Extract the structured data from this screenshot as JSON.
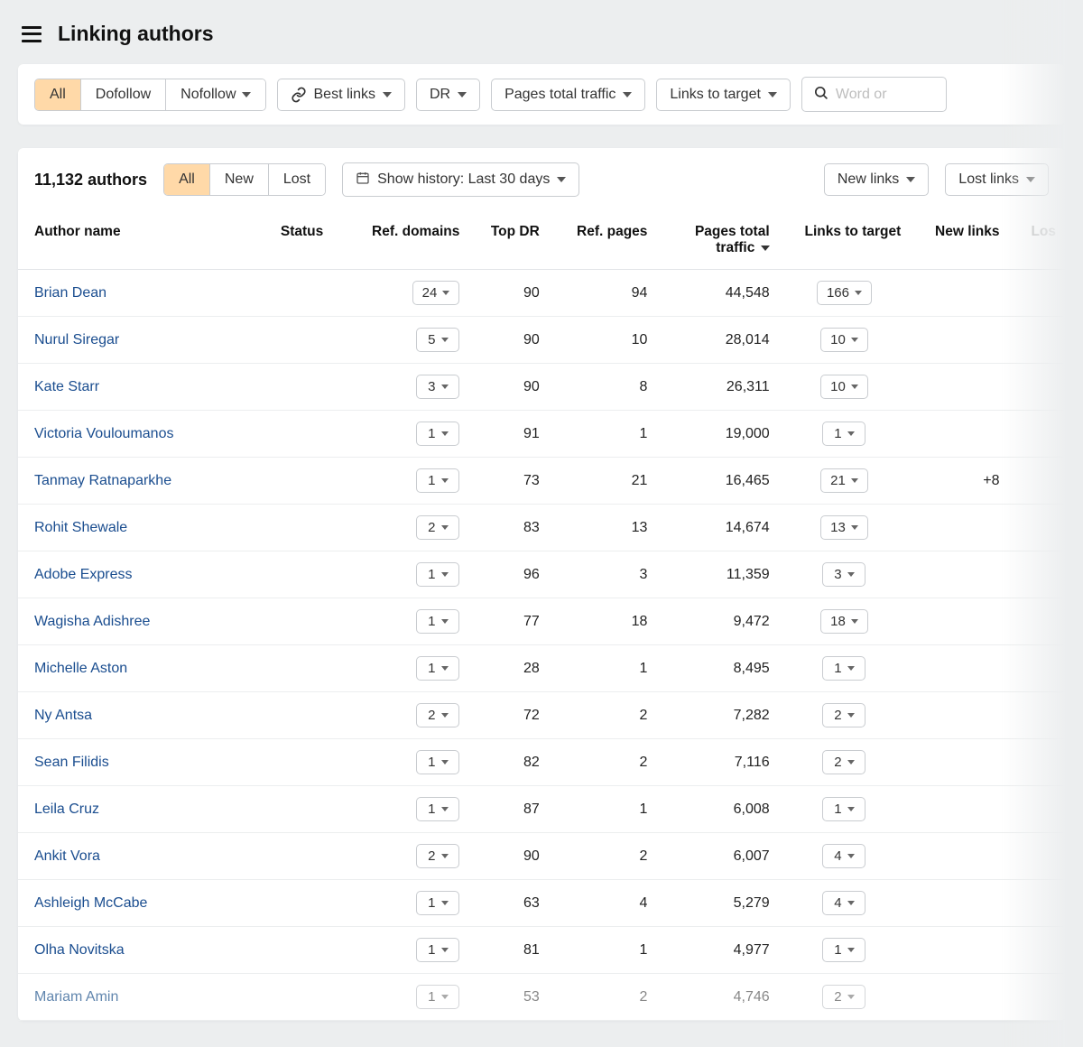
{
  "page": {
    "title": "Linking authors"
  },
  "filterTabs": {
    "all": "All",
    "dofollow": "Dofollow",
    "nofollow": "Nofollow"
  },
  "filterButtons": {
    "bestLinks": "Best links",
    "dr": "DR",
    "pagesTraffic": "Pages total traffic",
    "linksToTarget": "Links to target"
  },
  "search": {
    "placeholder": "Word or"
  },
  "counter": {
    "text": "11,132 authors"
  },
  "statusTabs": {
    "all": "All",
    "new": "New",
    "lost": "Lost"
  },
  "historyBtn": {
    "label": "Show history: Last 30 days"
  },
  "linkBtns": {
    "newLinks": "New links",
    "lostLinks": "Lost links"
  },
  "columns": {
    "author": "Author name",
    "status": "Status",
    "refDomains": "Ref. domains",
    "topDr": "Top DR",
    "refPages": "Ref. pages",
    "pagesTraffic": "Pages total traffic",
    "linksToTarget": "Links to target",
    "newLinks": "New links",
    "lostLinks": "Los"
  },
  "rows": [
    {
      "author": "Brian Dean",
      "refDomains": "24",
      "topDr": "90",
      "refPages": "94",
      "traffic": "44,548",
      "linksToTarget": "166",
      "newLinks": ""
    },
    {
      "author": "Nurul Siregar",
      "refDomains": "5",
      "topDr": "90",
      "refPages": "10",
      "traffic": "28,014",
      "linksToTarget": "10",
      "newLinks": ""
    },
    {
      "author": "Kate Starr",
      "refDomains": "3",
      "topDr": "90",
      "refPages": "8",
      "traffic": "26,311",
      "linksToTarget": "10",
      "newLinks": ""
    },
    {
      "author": "Victoria Vouloumanos",
      "refDomains": "1",
      "topDr": "91",
      "refPages": "1",
      "traffic": "19,000",
      "linksToTarget": "1",
      "newLinks": ""
    },
    {
      "author": "Tanmay Ratnaparkhe",
      "refDomains": "1",
      "topDr": "73",
      "refPages": "21",
      "traffic": "16,465",
      "linksToTarget": "21",
      "newLinks": "+8"
    },
    {
      "author": "Rohit Shewale",
      "refDomains": "2",
      "topDr": "83",
      "refPages": "13",
      "traffic": "14,674",
      "linksToTarget": "13",
      "newLinks": ""
    },
    {
      "author": "Adobe Express",
      "refDomains": "1",
      "topDr": "96",
      "refPages": "3",
      "traffic": "11,359",
      "linksToTarget": "3",
      "newLinks": ""
    },
    {
      "author": "Wagisha Adishree",
      "refDomains": "1",
      "topDr": "77",
      "refPages": "18",
      "traffic": "9,472",
      "linksToTarget": "18",
      "newLinks": ""
    },
    {
      "author": "Michelle Aston",
      "refDomains": "1",
      "topDr": "28",
      "refPages": "1",
      "traffic": "8,495",
      "linksToTarget": "1",
      "newLinks": ""
    },
    {
      "author": "Ny Antsa",
      "refDomains": "2",
      "topDr": "72",
      "refPages": "2",
      "traffic": "7,282",
      "linksToTarget": "2",
      "newLinks": ""
    },
    {
      "author": "Sean Filidis",
      "refDomains": "1",
      "topDr": "82",
      "refPages": "2",
      "traffic": "7,116",
      "linksToTarget": "2",
      "newLinks": ""
    },
    {
      "author": "Leila Cruz",
      "refDomains": "1",
      "topDr": "87",
      "refPages": "1",
      "traffic": "6,008",
      "linksToTarget": "1",
      "newLinks": ""
    },
    {
      "author": "Ankit Vora",
      "refDomains": "2",
      "topDr": "90",
      "refPages": "2",
      "traffic": "6,007",
      "linksToTarget": "4",
      "newLinks": ""
    },
    {
      "author": "Ashleigh McCabe",
      "refDomains": "1",
      "topDr": "63",
      "refPages": "4",
      "traffic": "5,279",
      "linksToTarget": "4",
      "newLinks": ""
    },
    {
      "author": "Olha Novitska",
      "refDomains": "1",
      "topDr": "81",
      "refPages": "1",
      "traffic": "4,977",
      "linksToTarget": "1",
      "newLinks": ""
    },
    {
      "author": "Mariam Amin",
      "refDomains": "1",
      "topDr": "53",
      "refPages": "2",
      "traffic": "4,746",
      "linksToTarget": "2",
      "newLinks": "",
      "fade": true
    }
  ]
}
